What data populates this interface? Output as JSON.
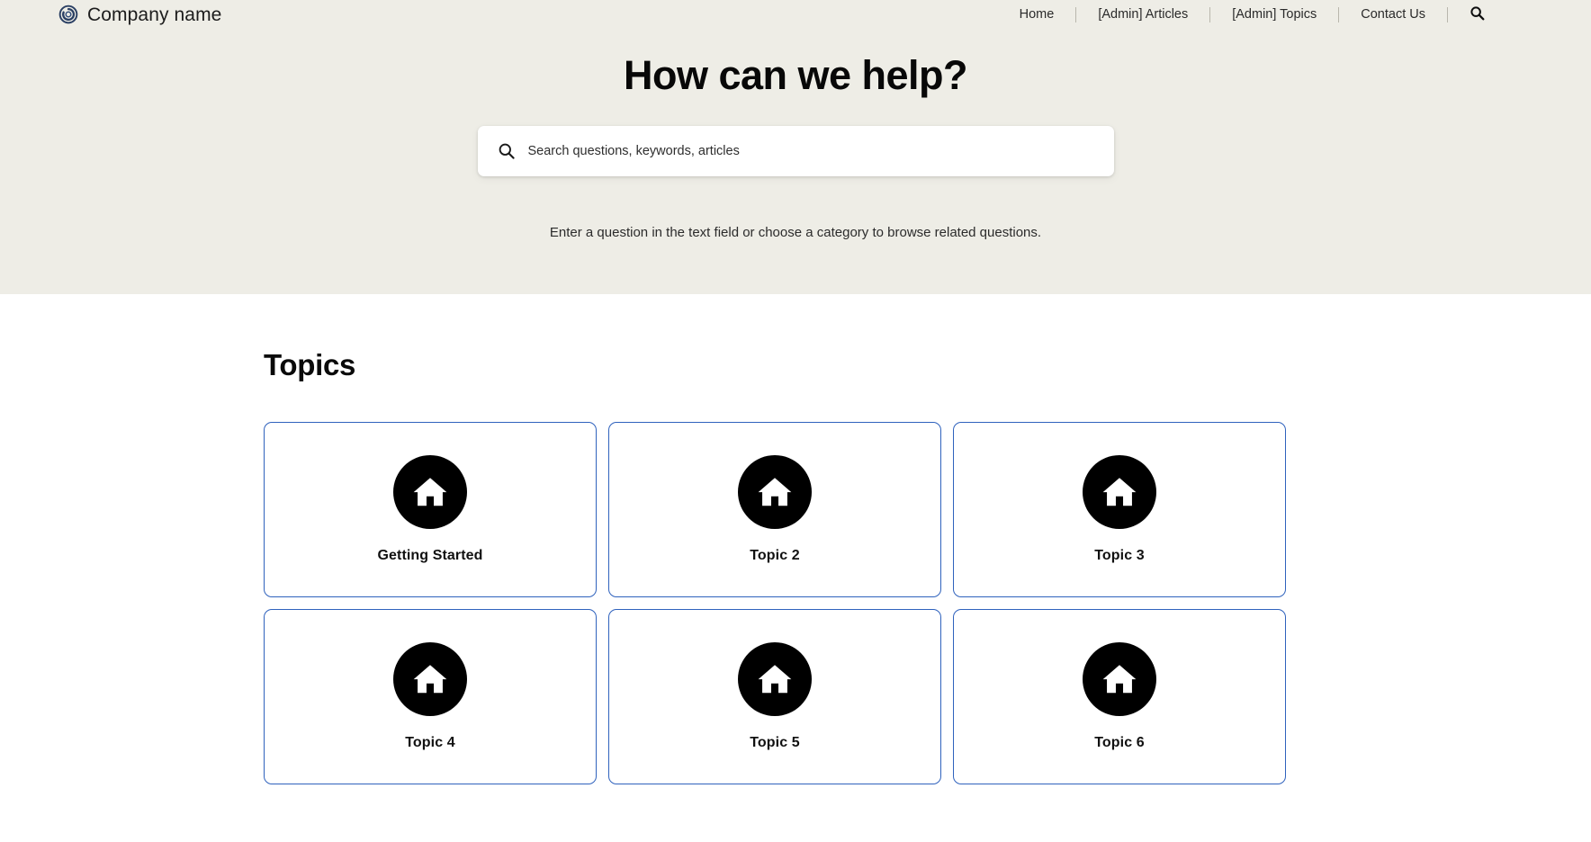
{
  "header": {
    "brand": {
      "name": "Company name",
      "logo_icon": "circle-spiral-logo-icon",
      "logo_color": "#2a3f63"
    },
    "nav": {
      "items": [
        {
          "label": "Home"
        },
        {
          "label": "[Admin] Articles"
        },
        {
          "label": "[Admin] Topics"
        },
        {
          "label": "Contact Us"
        }
      ],
      "search_icon": "search-icon"
    }
  },
  "hero": {
    "title": "How can we help?",
    "search": {
      "icon": "search-icon",
      "placeholder": "Search questions, keywords, articles",
      "value": ""
    },
    "subtitle": "Enter a question in the text field or choose a category to browse related questions.",
    "background_color": "#eeede6"
  },
  "topics": {
    "heading": "Topics",
    "card_border_color": "#2f62bd",
    "icon_background_color": "#000000",
    "items": [
      {
        "label": "Getting Started",
        "icon": "home-icon"
      },
      {
        "label": "Topic 2",
        "icon": "home-icon"
      },
      {
        "label": "Topic 3",
        "icon": "home-icon"
      },
      {
        "label": "Topic 4",
        "icon": "home-icon"
      },
      {
        "label": "Topic 5",
        "icon": "home-icon"
      },
      {
        "label": "Topic 6",
        "icon": "home-icon"
      }
    ]
  }
}
